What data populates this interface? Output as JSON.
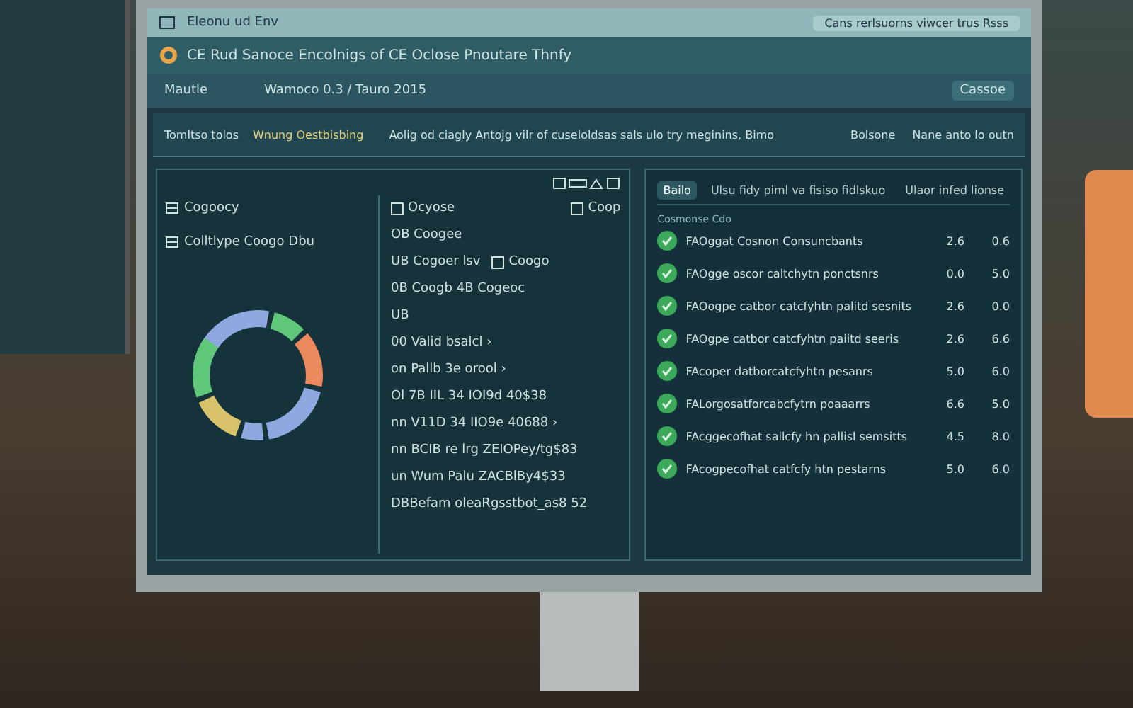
{
  "browser": {
    "tab_title": "Eleonu ud Env",
    "address": "Cans rerlsuorns viwcer trus Rsss"
  },
  "app": {
    "title": "CE Rud Sanoce Encolnigs of CE Oclose Pnoutare Thnfy",
    "nav_label": "Mautle",
    "breadcrumb": "Wamoco 0.3 / Tauro 2015",
    "action": "Cassoe"
  },
  "info_bar": {
    "label": "Tomltso tolos",
    "tag": "Wnung Oestbisbing",
    "message": "Aolig od ciagly Antojg vilr of cuseloldsas sals ulo try meginins, Bimo",
    "links": [
      "Bolsone",
      "Nane anto lo outn"
    ]
  },
  "left_panel": {
    "categories": [
      "Cogoocy",
      "Colltlype Coogo Dbu"
    ],
    "options": [
      {
        "label": "Ocyose",
        "checked": false
      },
      {
        "label": "Coop",
        "checked": false
      }
    ],
    "list": [
      {
        "text": "OB Coogee"
      },
      {
        "text": "UB Cogoer lsv",
        "checkbox": {
          "label": "Coogo",
          "checked": false
        }
      },
      {
        "text": "0B Coogb 4B Cogeoc"
      },
      {
        "text": "UB"
      },
      {
        "text": "00 Valid bsalcl  ›"
      },
      {
        "text": "on Pallb 3e orool  ›"
      },
      {
        "text": "Ol 7B IIL 34 IOI9d 40$38"
      },
      {
        "text": "nn V11D 34 IIO9e 40688  ›"
      },
      {
        "text": "nn BCIB re lrg ZEIOPey/tg$83"
      },
      {
        "text": "un Wum Palu ZACBlBy4$33"
      },
      {
        "text": "DBBefam oleaRgsstbot_as8 52"
      }
    ]
  },
  "right_panel": {
    "tabs": [
      {
        "label": "Bailo",
        "selected": true
      },
      {
        "label": "Ulsu fidy piml va fisiso fidlskuo",
        "selected": false
      },
      {
        "label": "Ulaor infed lionse",
        "selected": false
      }
    ],
    "section_title": "Cosmonse Cdo",
    "items": [
      {
        "text": "FAOggat Cosnon Consuncbants",
        "done": true,
        "value_1": "2.6",
        "value_2": "0.6"
      },
      {
        "text": "FAOgge oscor caltchytn ponctsnrs",
        "done": true,
        "value_1": "0.0",
        "value_2": "5.0"
      },
      {
        "text": "FAOogpe catbor catcfyhtn palitd sesnits",
        "done": true,
        "value_1": "2.6",
        "value_2": "0.0"
      },
      {
        "text": "FAOgpe catbor catcfyhtn paiitd seeris",
        "done": true,
        "value_1": "2.6",
        "value_2": "6.6"
      },
      {
        "text": "FAcoper datborcatcfyhtn pesanrs",
        "done": true,
        "value_1": "5.0",
        "value_2": "6.0"
      },
      {
        "text": "FALorgosatforcabcfytrn poaaarrs",
        "done": true,
        "value_1": "6.6",
        "value_2": "5.0"
      },
      {
        "text": "FAcggecofhat sallcfy hn pallisl semsitts",
        "done": true,
        "value_1": "4.5",
        "value_2": "8.0"
      },
      {
        "text": "FAcogpecofhat catfcfy htn pestarns",
        "done": true,
        "value_1": "5.0",
        "value_2": "6.0"
      }
    ]
  }
}
